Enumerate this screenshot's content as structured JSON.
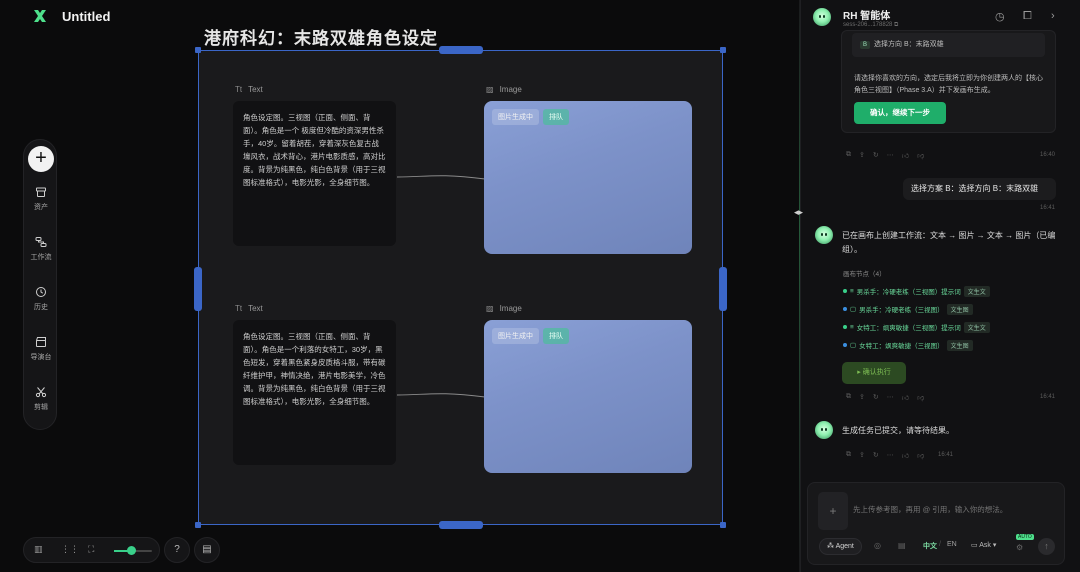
{
  "app": {
    "title": "Untitled"
  },
  "canvas": {
    "group_title": "港府科幻：末路双雄角色设定",
    "nodes": [
      {
        "type_label": "Text",
        "text": "角色设定图。三视图（正面、侧面、背面）。角色是一个 极度但冷酷的资深男性杀手，40岁。留着胡茬，穿着深灰色复古战壕风衣，战术背心，港片电影质感，高对比度。背景为纯黑色，纯白色背景（用于三视图标准格式），电影光影，全身细节图。"
      },
      {
        "type_label": "Image",
        "status": "图片生成中",
        "tag": "排队"
      },
      {
        "type_label": "Text",
        "text": "角色设定图。三视图（正面、侧面、背面）。角色是一个利落的女特工，30岁，黑色短发，穿着黑色紧身皮质格斗服，带有碳纤维护甲，神情决绝，港片电影美学，冷色调。背景为纯黑色，纯白色背景（用于三视图标准格式），电影光影，全身细节图。"
      },
      {
        "type_label": "Image",
        "status": "图片生成中",
        "tag": "排队"
      }
    ]
  },
  "dock": {
    "add": "+",
    "items": [
      {
        "label": "资产",
        "icon": "box-icon"
      },
      {
        "label": "工作流",
        "icon": "workflow-icon"
      },
      {
        "label": "历史",
        "icon": "history-icon"
      },
      {
        "label": "导演台",
        "icon": "clapper-icon"
      },
      {
        "label": "剪辑",
        "icon": "scissors-icon"
      }
    ]
  },
  "zoom": {
    "level": 0.45
  },
  "panel": {
    "name": "RH 智能体",
    "sub": "sess-206...178828",
    "card": {
      "option": "选择方向 B：末路双雄",
      "option_badge": "B",
      "desc": "请选择你喜欢的方向，选定后我将立即为你创建两人的【核心角色三视图】（Phase 3.A）并下发画布生成。",
      "confirm": "确认，继续下一步",
      "time": "16:40"
    },
    "user_msg": {
      "text": "选择方案 B：选择方向 B：末路双雄",
      "time": "16:41"
    },
    "bot_msg_1": "已在画布上创建工作流：文本 → 图片 → 文本 → 图片（已编组）。",
    "nodes_label": "画布节点（4）",
    "node_list": [
      {
        "name": "男杀手：冷硬老练（三视图）提示词",
        "chip": "文生文",
        "dot": "#39d08a",
        "glyph": "≡"
      },
      {
        "name": "男杀手：冷硬老练（三视图）",
        "chip": "文生图",
        "dot": "#3b8fe0",
        "glyph": "▢"
      },
      {
        "name": "女特工：飒爽敏捷（三视图）提示词",
        "chip": "文生文",
        "dot": "#39d08a",
        "glyph": "≡"
      },
      {
        "name": "女特工：飒爽敏捷（三视图）",
        "chip": "文生图",
        "dot": "#3b8fe0",
        "glyph": "▢"
      }
    ],
    "exec_button": "确认执行",
    "time_2": "16:41",
    "bot_msg_2": "生成任务已提交，请等待结果。",
    "time_3": "16:41"
  },
  "composer": {
    "placeholder": "先上传参考图，再用 @ 引用，输入你的想法。",
    "agent": "Agent",
    "lang_on": "中文",
    "lang_off": "EN",
    "ask": "Ask",
    "auto_badge": "AUTO"
  },
  "colors": {
    "accent": "#1fae6a",
    "selection": "#3b66c7"
  }
}
